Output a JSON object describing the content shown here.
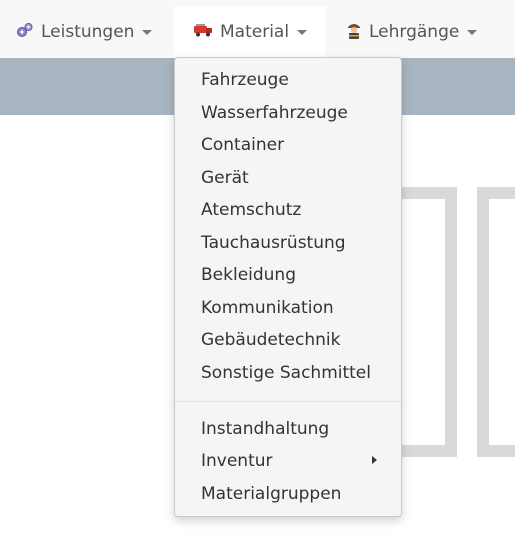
{
  "navbar": {
    "items": [
      {
        "label": "Leistungen",
        "icon": "gears-icon"
      },
      {
        "label": "Material",
        "icon": "fire-truck-icon"
      },
      {
        "label": "Lehrgänge",
        "icon": "firefighter-icon"
      }
    ]
  },
  "material_menu": {
    "group1": [
      "Fahrzeuge",
      "Wasserfahrzeuge",
      "Container",
      "Gerät",
      "Atemschutz",
      "Tauchausrüstung",
      "Bekleidung",
      "Kommunikation",
      "Gebäudetechnik",
      "Sonstige Sachmittel"
    ],
    "group2": [
      "Instandhaltung",
      "Inventur",
      "Materialgruppen"
    ]
  }
}
